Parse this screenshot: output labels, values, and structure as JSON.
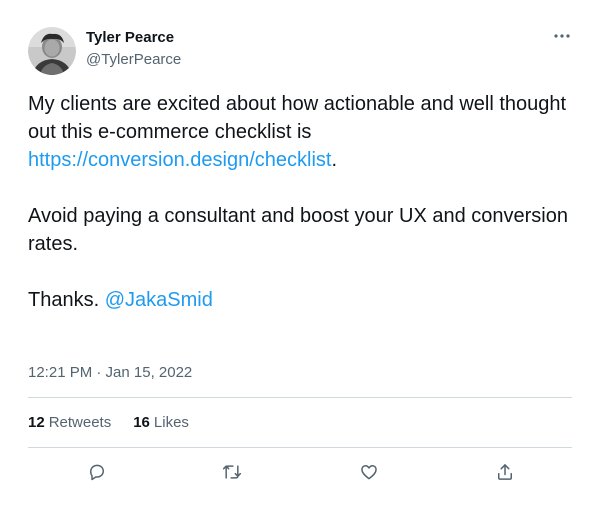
{
  "tweet": {
    "author": {
      "display_name": "Tyler Pearce",
      "handle": "@TylerPearce",
      "avatar_icon": "avatar-photo"
    },
    "more_icon": "more-dots-icon",
    "text": {
      "line1": "My clients are excited about how actionable and well thought out this e-commerce checklist is",
      "link": "https://conversion.design/checklist",
      "link_suffix": ".",
      "line2": "Avoid paying a consultant and boost your UX and conversion rates.",
      "line3_prefix": "Thanks. ",
      "mention": "@JakaSmid"
    },
    "timestamp": "12:21 PM · Jan 15, 2022",
    "stats": {
      "retweets_count": "12",
      "retweets_label": "Retweets",
      "likes_count": "16",
      "likes_label": "Likes"
    },
    "actions": [
      "reply-icon",
      "retweet-icon",
      "like-icon",
      "share-icon"
    ],
    "colors": {
      "link": "#1d9bf0",
      "secondary_text": "#536471",
      "divider": "#cfd9de"
    }
  }
}
